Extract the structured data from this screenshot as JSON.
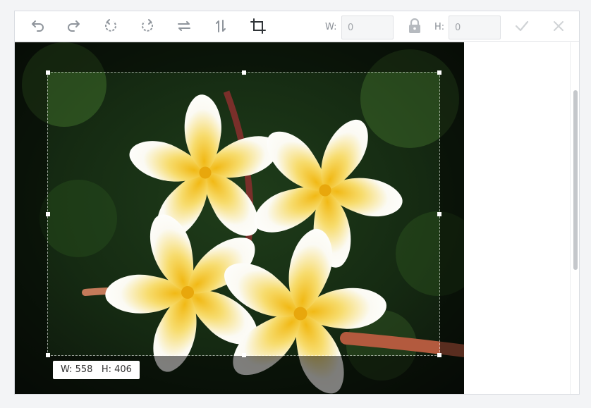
{
  "toolbar": {
    "icons": [
      "undo-icon",
      "redo-icon",
      "rotate-left-icon",
      "rotate-right-icon",
      "flip-horizontal-icon",
      "flip-vertical-icon",
      "crop-icon",
      "lock-icon",
      "apply-check-icon",
      "cancel-close-icon"
    ],
    "width_label": "W:",
    "width_value": "0",
    "height_label": "H:",
    "height_value": "0"
  },
  "crop": {
    "size_width_text": "W: 558",
    "size_height_text": "H: 406"
  },
  "colors": {
    "icon_default": "#8f959c",
    "icon_active": "#2f3337",
    "icon_disabled": "#d0d3d6",
    "overlay": "rgba(0,0,0,0.5)"
  }
}
